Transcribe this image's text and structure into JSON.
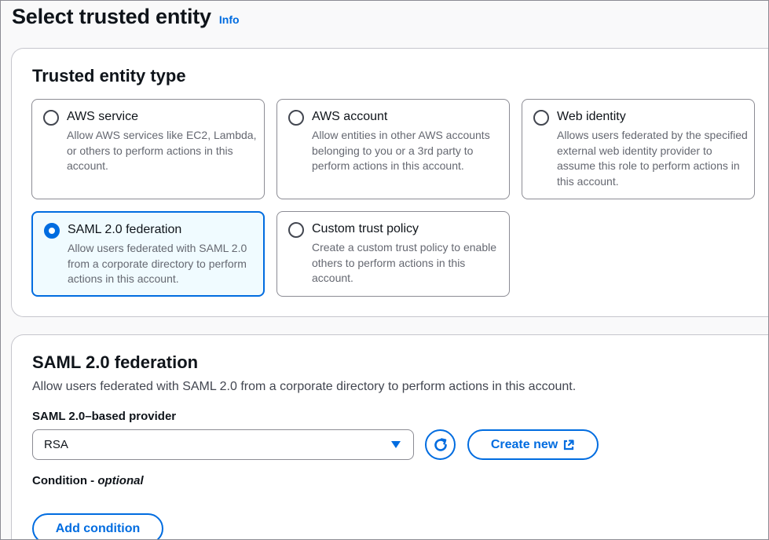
{
  "header": {
    "title": "Select trusted entity",
    "info_link": "Info"
  },
  "trusted_entity": {
    "title": "Trusted entity type",
    "options": [
      {
        "label": "AWS service",
        "description": "Allow AWS services like EC2, Lambda, or others to perform actions in this account.",
        "selected": false
      },
      {
        "label": "AWS account",
        "description": "Allow entities in other AWS accounts belonging to you or a 3rd party to perform actions in this account.",
        "selected": false
      },
      {
        "label": "Web identity",
        "description": "Allows users federated by the specified external web identity provider to assume this role to perform actions in this account.",
        "selected": false
      },
      {
        "label": "SAML 2.0 federation",
        "description": "Allow users federated with SAML 2.0 from a corporate directory to perform actions in this account.",
        "selected": true
      },
      {
        "label": "Custom trust policy",
        "description": "Create a custom trust policy to enable others to perform actions in this account.",
        "selected": false
      }
    ]
  },
  "saml": {
    "title": "SAML 2.0 federation",
    "description": "Allow users federated with SAML 2.0 from a corporate directory to perform actions in this account.",
    "provider_label": "SAML 2.0–based provider",
    "provider_value": "RSA",
    "create_new_label": "Create new",
    "condition_label": "Condition - ",
    "condition_optional": "optional",
    "add_condition_label": "Add condition"
  },
  "colors": {
    "accent": "#006ce0",
    "selected_bg": "#f0fbff",
    "text": "#0f141a",
    "muted": "#656871"
  },
  "icons": {
    "refresh": "refresh-icon",
    "external": "external-link-icon",
    "caret": "caret-down-icon"
  }
}
